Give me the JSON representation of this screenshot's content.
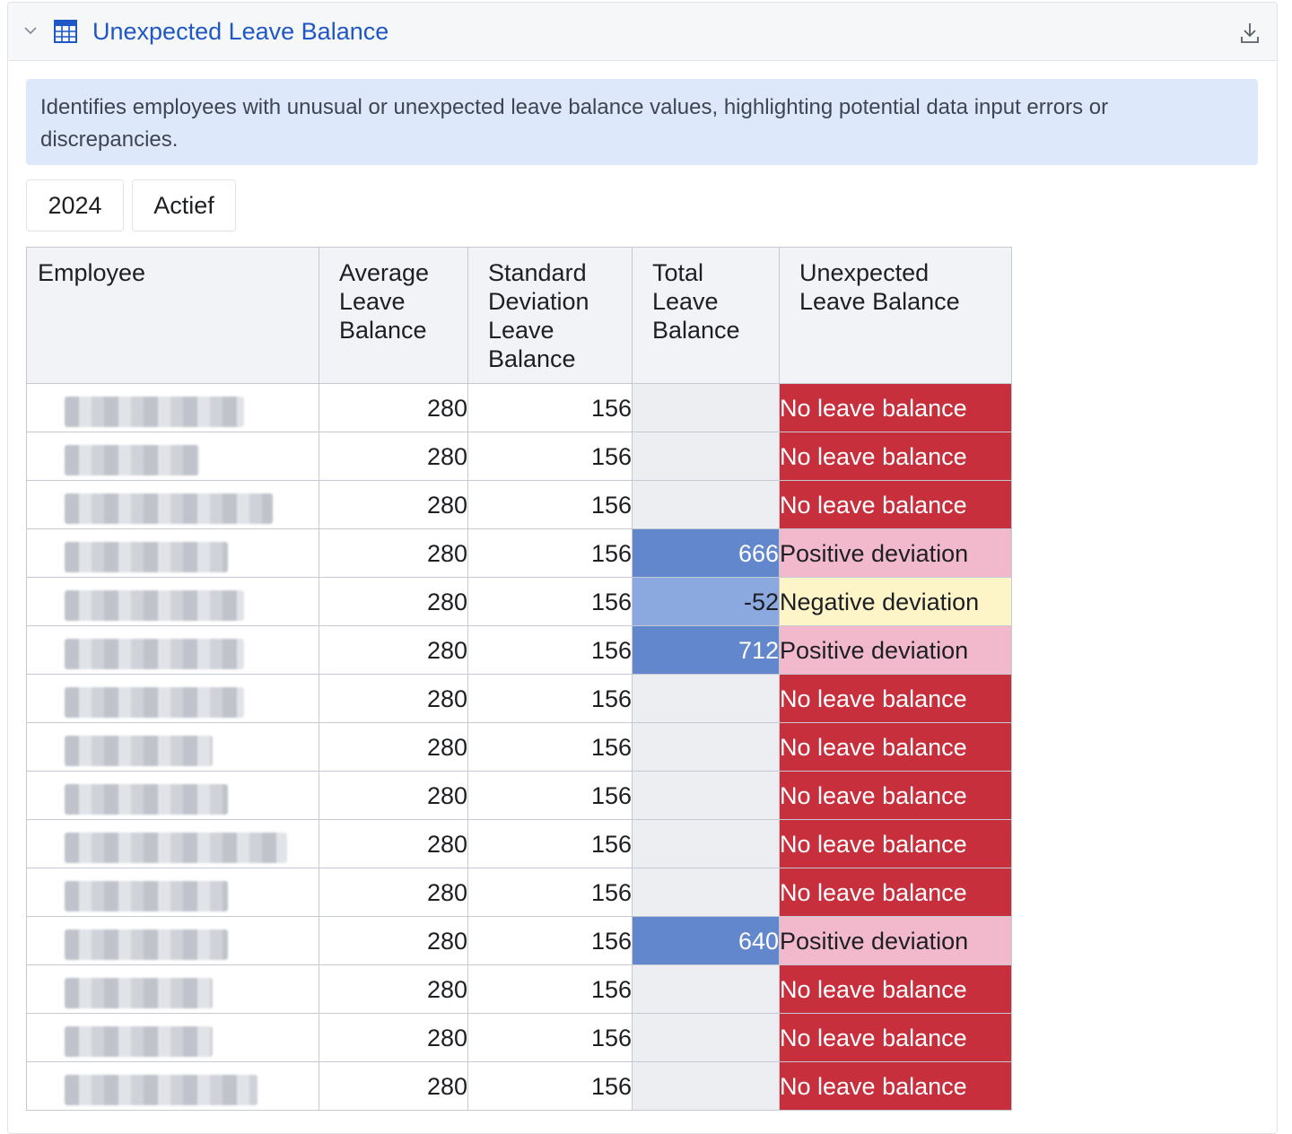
{
  "panel": {
    "title": "Unexpected Leave Balance",
    "description": "Identifies employees with unusual or unexpected leave balance values, highlighting potential data input errors or discrepancies.",
    "filters": {
      "year": "2024",
      "status": "Actief"
    }
  },
  "colors": {
    "title": "#1f57c4",
    "no_leave": "#c72f3d",
    "positive": "#f2b9cd",
    "negative": "#fdf4c8",
    "total_strong": "#6287cc",
    "total_light": "#8ca9df"
  },
  "icons": {
    "collapse": "chevron-down-icon",
    "table": "table-icon",
    "download": "download-icon"
  },
  "table": {
    "columns": [
      "Employee",
      "Average Leave Balance",
      "Standard Deviation Leave Balance",
      "Total Leave Balance",
      "Unexpected Leave Balance"
    ],
    "rows": [
      {
        "avg": "280",
        "std": "156",
        "total": "",
        "flag": "No leave balance",
        "kind": "none"
      },
      {
        "avg": "280",
        "std": "156",
        "total": "",
        "flag": "No leave balance",
        "kind": "none"
      },
      {
        "avg": "280",
        "std": "156",
        "total": "",
        "flag": "No leave balance",
        "kind": "none"
      },
      {
        "avg": "280",
        "std": "156",
        "total": "666",
        "flag": "Positive deviation",
        "kind": "pos"
      },
      {
        "avg": "280",
        "std": "156",
        "total": "-52",
        "flag": "Negative deviation",
        "kind": "neg"
      },
      {
        "avg": "280",
        "std": "156",
        "total": "712",
        "flag": "Positive deviation",
        "kind": "pos"
      },
      {
        "avg": "280",
        "std": "156",
        "total": "",
        "flag": "No leave balance",
        "kind": "none"
      },
      {
        "avg": "280",
        "std": "156",
        "total": "",
        "flag": "No leave balance",
        "kind": "none"
      },
      {
        "avg": "280",
        "std": "156",
        "total": "",
        "flag": "No leave balance",
        "kind": "none"
      },
      {
        "avg": "280",
        "std": "156",
        "total": "",
        "flag": "No leave balance",
        "kind": "none"
      },
      {
        "avg": "280",
        "std": "156",
        "total": "",
        "flag": "No leave balance",
        "kind": "none"
      },
      {
        "avg": "280",
        "std": "156",
        "total": "640",
        "flag": "Positive deviation",
        "kind": "pos"
      },
      {
        "avg": "280",
        "std": "156",
        "total": "",
        "flag": "No leave balance",
        "kind": "none"
      },
      {
        "avg": "280",
        "std": "156",
        "total": "",
        "flag": "No leave balance",
        "kind": "none"
      },
      {
        "avg": "280",
        "std": "156",
        "total": "",
        "flag": "No leave balance",
        "kind": "none"
      }
    ]
  }
}
